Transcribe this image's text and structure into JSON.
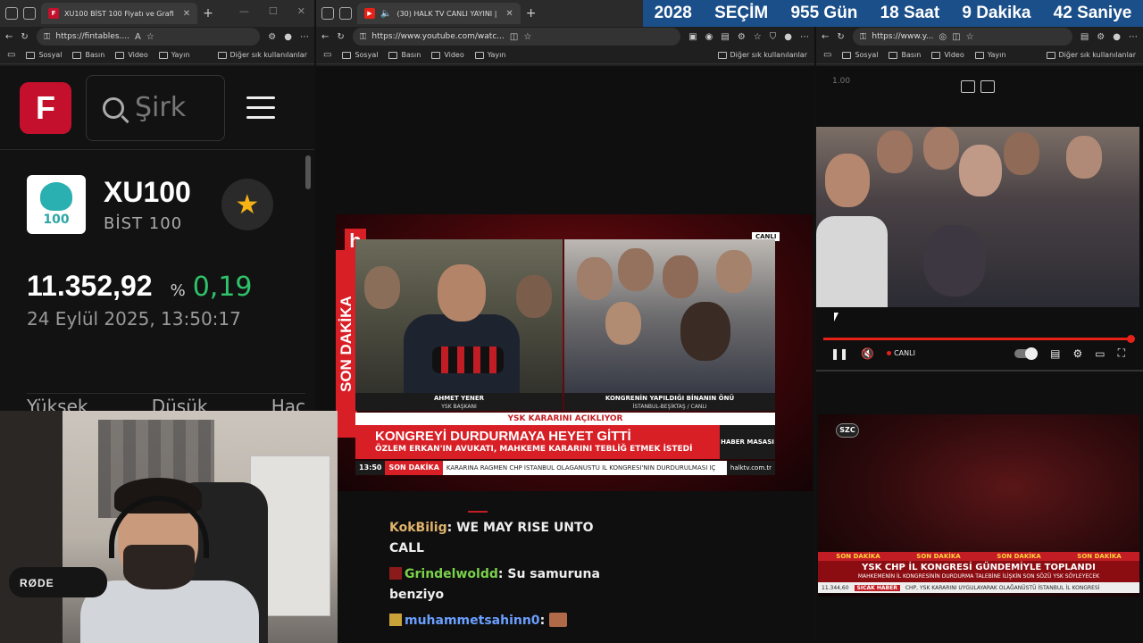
{
  "countdown": {
    "year": "2028",
    "label": "SEÇİM",
    "days": "955 Gün",
    "hours": "18 Saat",
    "minutes": "9 Dakika",
    "seconds": "42 Saniye"
  },
  "bookmarks": {
    "items": [
      "Sosyal",
      "Basın",
      "Video",
      "Yayın"
    ],
    "other": "Diğer sık kullanılanlar"
  },
  "win1": {
    "tab_title": "XU100 BİST 100 Fiyatı ve Grafi",
    "url": "https://fintables....",
    "search_placeholder": "Şirk",
    "logo_letter": "F",
    "symbol": "XU100",
    "index_logo_text": "100",
    "subname": "BİST 100",
    "price": "11.352,92",
    "pct_sign": "%",
    "change": "0,19",
    "datetime": "24 Eylül 2025, 13:50:17",
    "stats": [
      "Yüksek",
      "Düşük",
      "Hac"
    ]
  },
  "win2": {
    "tab_title": "(30) HALK TV CANLI YAYINI |",
    "url": "https://www.youtube.com/watc...",
    "video": {
      "channel_logo": "h",
      "side_label": "SON DAKİKA",
      "live_tag": "CANLI",
      "left_name": "AHMET YENER",
      "left_role": "YSK BAŞKANI",
      "right_name": "KONGRENİN YAPILDIĞI BİNANIN ÖNÜ",
      "right_role": "İSTANBUL-BEŞİKTAŞ / CANLI",
      "topic": "YSK KARARINI AÇIKLIYOR",
      "headline": "KONGREYİ DURDURMAYA HEYET GİTTİ",
      "subheadline": "ÖZLEM ERKAN'IN AVUKATI, MAHKEME KARARINI TEBLİĞ ETMEK İSTEDİ",
      "desk": "HABER MASASI",
      "ticker_time": "13:50",
      "ticker_label": "SON DAKİKA",
      "ticker_text": "KARARINA RAĞMEN CHP İSTANBUL OLAĞANÜSTÜ İL KONGRESİ'NİN DURDURULMASI İÇ",
      "ticker_site": "halktv.com.tr"
    },
    "chat": [
      {
        "user": "KokBilig",
        "msg": "WE MAY RISE UNTO CALL",
        "color": "#e0b36a"
      },
      {
        "user": "Grindelwoldd",
        "msg": "Su samuruna benziyo",
        "color": "#7ad14a"
      },
      {
        "user": "muhammetsahinn0",
        "msg": "",
        "color": "#6a9fff"
      }
    ]
  },
  "win3": {
    "url": "https://www.y...",
    "rate": "1.00",
    "live_label": "CANLI",
    "szc": {
      "logo": "SZC",
      "sd_items": [
        "SON DAKİKA",
        "SON DAKİKA",
        "SON DAKİKA",
        "SON DAKİKA"
      ],
      "headline": "YSK CHP İL KONGRESİ GÜNDEMİYLE TOPLANDI",
      "subheadline": "MAHKEMENİN İL KONGRESİNİN DURDURMA TALEBİNE İLİŞKİN SON SÖZÜ YSK SÖYLEYECEK",
      "ticker_value": "11.344,60",
      "ticker_label": "SICAK HABER",
      "ticker_text": "CHP, YSK KARARINI UYGULAYARAK OLAĞANÜSTÜ İSTANBUL İL KONGRESİ"
    }
  },
  "cam": {
    "mic_brand": "RØDE"
  },
  "colors": {
    "accent_red": "#d81f26",
    "up_green": "#2fc36a",
    "banner_blue": "#1b4f8a"
  }
}
